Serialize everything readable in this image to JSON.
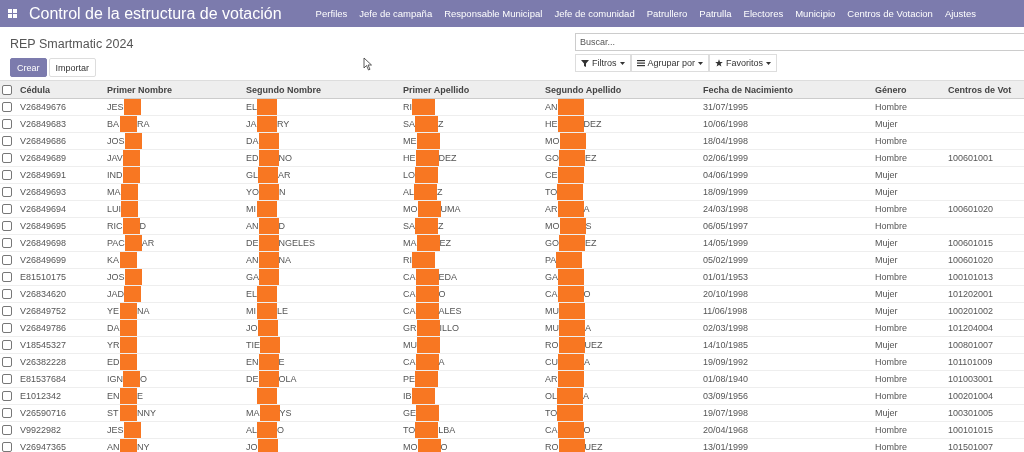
{
  "app_bar": {
    "title": "Control de la estructura de votación",
    "menu": [
      "Perfiles",
      "Jefe de campaña",
      "Responsable Municipal",
      "Jefe de comunidad",
      "Patrullero",
      "Patrulla",
      "Electores",
      "Municipio",
      "Centros de Votacion",
      "Ajustes"
    ]
  },
  "breadcrumb": "REP Smartmatic 2024",
  "buttons": [
    "Crear",
    "Importar"
  ],
  "search": {
    "placeholder": "Buscar..."
  },
  "search_options": [
    {
      "kind": "filter",
      "label": "Filtros"
    },
    {
      "kind": "group",
      "label": "Agrupar por"
    },
    {
      "kind": "favorite",
      "label": "Favoritos"
    }
  ],
  "table": {
    "all_checked": false,
    "columns": [
      {
        "label": "Cédula",
        "redacted": false
      },
      {
        "label": "Primer Nombre",
        "redacted": true
      },
      {
        "label": "Segundo Nombre",
        "redacted": true
      },
      {
        "label": "Primer Apellido",
        "redacted": true
      },
      {
        "label": "Segundo Apellido",
        "redacted": true
      },
      {
        "label": "Fecha de Nacimiento",
        "redacted": false
      },
      {
        "label": "Género",
        "redacted": false
      },
      {
        "label": "Centros de Vot",
        "redacted": false
      }
    ],
    "rows": [
      {
        "checked": false,
        "cells": [
          "V26849676",
          {
            "before": "JES"
          },
          {
            "before": "EL"
          },
          {
            "before": "RI"
          },
          {
            "before": "AN"
          },
          "31/07/1995",
          "Hombre"
        ]
      },
      {
        "checked": false,
        "cells": [
          "V26849683",
          {
            "before": "BA",
            "after": "RA"
          },
          {
            "before": "JA",
            "after": "RY"
          },
          {
            "before": "SA",
            "after": "Z"
          },
          {
            "before": "HE",
            "after": "DEZ"
          },
          "10/06/1998",
          "Mujer"
        ]
      },
      {
        "checked": false,
        "cells": [
          "V26849686",
          {
            "before": "JOS"
          },
          {
            "before": "DA"
          },
          {
            "before": "ME"
          },
          {
            "before": "MO"
          },
          "18/04/1998",
          "Hombre"
        ]
      },
      {
        "checked": false,
        "cells": [
          "V26849689",
          {
            "before": "JAV"
          },
          {
            "before": "ED",
            "after": "NO"
          },
          {
            "before": "HE",
            "after": "DEZ"
          },
          {
            "before": "GO",
            "after": "EZ"
          },
          "02/06/1999",
          "Hombre",
          "100601001"
        ]
      },
      {
        "checked": false,
        "cells": [
          "V26849691",
          {
            "before": "IND"
          },
          {
            "before": "GL",
            "after": "AR"
          },
          {
            "before": "LO"
          },
          {
            "before": "CE"
          },
          "04/06/1999",
          "Mujer"
        ]
      },
      {
        "checked": false,
        "cells": [
          "V26849693",
          {
            "before": "MA"
          },
          {
            "before": "YO",
            "after": "N"
          },
          {
            "before": "AL",
            "after": "Z"
          },
          {
            "before": "TO"
          },
          "18/09/1999",
          "Mujer"
        ]
      },
      {
        "checked": false,
        "cells": [
          "V26849694",
          {
            "before": "LUI"
          },
          {
            "before": "MI"
          },
          {
            "before": "MO",
            "after": "UMA"
          },
          {
            "before": "AR",
            "after": "A"
          },
          "24/03/1998",
          "Hombre",
          "100601020"
        ]
      },
      {
        "checked": false,
        "cells": [
          "V26849695",
          {
            "before": "RIC",
            "after": "D"
          },
          {
            "before": "AN",
            "after": "D"
          },
          {
            "before": "SA",
            "after": "Z"
          },
          {
            "before": "MO",
            "after": "S"
          },
          "06/05/1997",
          "Hombre"
        ]
      },
      {
        "checked": false,
        "cells": [
          "V26849698",
          {
            "before": "PAC",
            "after": "AR"
          },
          {
            "before": "DE",
            "after": "NGELES"
          },
          {
            "before": "MA",
            "after": "EZ"
          },
          {
            "before": "GO",
            "after": "EZ"
          },
          "14/05/1999",
          "Mujer",
          "100601015"
        ]
      },
      {
        "checked": false,
        "cells": [
          "V26849699",
          {
            "before": "KA"
          },
          {
            "before": "AN",
            "after": "NA"
          },
          {
            "before": "RI"
          },
          {
            "before": "PA"
          },
          "05/02/1999",
          "Mujer",
          "100601020"
        ]
      },
      {
        "checked": false,
        "cells": [
          "E81510175",
          {
            "before": "JOS"
          },
          {
            "before": "GA"
          },
          {
            "before": "CA",
            "after": "EDA"
          },
          {
            "before": "GA"
          },
          "01/01/1953",
          "Hombre",
          "100101013"
        ]
      },
      {
        "checked": false,
        "cells": [
          "V26834620",
          {
            "before": "JAD"
          },
          {
            "before": "EL"
          },
          {
            "before": "CA",
            "after": "O"
          },
          {
            "before": "CA",
            "after": "O"
          },
          "20/10/1998",
          "Mujer",
          "101202001"
        ]
      },
      {
        "checked": false,
        "cells": [
          "V26849752",
          {
            "before": "YE",
            "after": "NA"
          },
          {
            "before": "MI",
            "after": "LE"
          },
          {
            "before": "CA",
            "after": "ALES"
          },
          {
            "before": "MU"
          },
          "11/06/1998",
          "Mujer",
          "100201002"
        ]
      },
      {
        "checked": false,
        "cells": [
          "V26849786",
          {
            "before": "DA"
          },
          {
            "before": "JO"
          },
          {
            "before": "GR",
            "after": "ILLO"
          },
          {
            "before": "MU",
            "after": "A"
          },
          "02/03/1998",
          "Hombre",
          "101204004"
        ]
      },
      {
        "checked": false,
        "cells": [
          "V18545327",
          {
            "before": "YR"
          },
          {
            "before": "TIE"
          },
          {
            "before": "MU"
          },
          {
            "before": "RO",
            "after": "UEZ"
          },
          "14/10/1985",
          "Mujer",
          "100801007"
        ]
      },
      {
        "checked": false,
        "cells": [
          "V26382228",
          {
            "before": "ED"
          },
          {
            "before": "EN",
            "after": "E"
          },
          {
            "before": "CA",
            "after": "A"
          },
          {
            "before": "CU",
            "after": "A"
          },
          "19/09/1992",
          "Hombre",
          "101101009"
        ]
      },
      {
        "checked": false,
        "cells": [
          "E81537684",
          {
            "before": "IGN",
            "after": "O"
          },
          {
            "before": "DE",
            "after": "OLA"
          },
          {
            "before": "PE"
          },
          {
            "before": "AR"
          },
          "01/08/1940",
          "Hombre",
          "101003001"
        ]
      },
      {
        "checked": false,
        "cells": [
          "E1012342",
          {
            "before": "EN",
            "after": "E"
          },
          {},
          {
            "before": "IB"
          },
          {
            "before": "OL",
            "after": "A"
          },
          "03/09/1956",
          "Hombre",
          "100201004"
        ]
      },
      {
        "checked": false,
        "cells": [
          "V26590716",
          {
            "before": "ST",
            "after": "NNY"
          },
          {
            "before": "MA",
            "after": "YS"
          },
          {
            "before": "GE"
          },
          {
            "before": "TO"
          },
          "19/07/1998",
          "Mujer",
          "100301005"
        ]
      },
      {
        "checked": false,
        "cells": [
          "V9922982",
          {
            "before": "JES"
          },
          {
            "before": "AL",
            "after": "O"
          },
          {
            "before": "TO",
            "after": "LBA"
          },
          {
            "before": "CA",
            "after": "O"
          },
          "20/04/1968",
          "Hombre",
          "100101015"
        ]
      },
      {
        "checked": false,
        "cells": [
          "V26947365",
          {
            "before": "AN",
            "after": "NY"
          },
          {
            "before": "JO"
          },
          {
            "before": "MO",
            "after": "O"
          },
          {
            "before": "RO",
            "after": "UEZ"
          },
          "13/01/1999",
          "Hombre",
          "101501007"
        ]
      }
    ]
  }
}
